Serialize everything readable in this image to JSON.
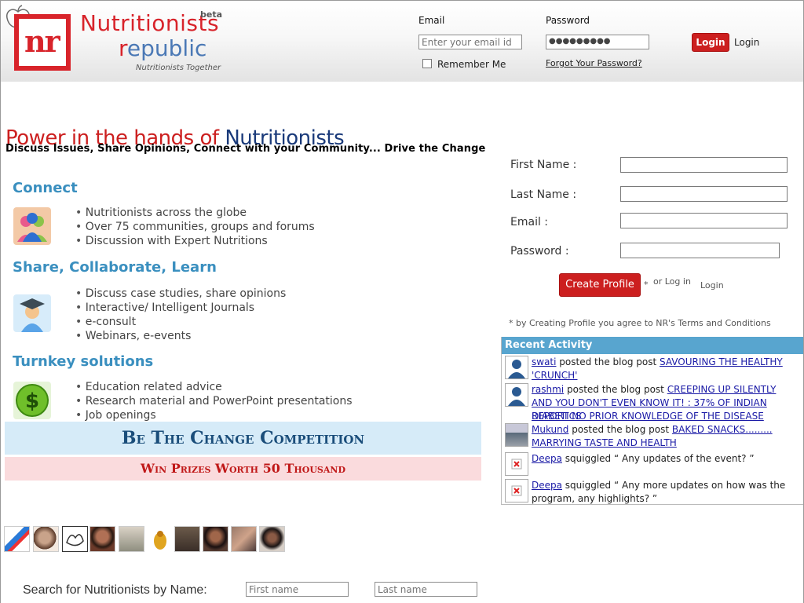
{
  "header": {
    "brand_line1": "Nutritionists",
    "brand_line2": "republic",
    "beta": "beta",
    "tagline": "Nutritionists Together",
    "logo_text": "nr",
    "email_label": "Email",
    "email_placeholder": "Enter your email id",
    "password_label": "Password",
    "password_value": "●●●●●●●●●",
    "remember_me": "Remember Me",
    "forgot_password": "Forgot Your Password?",
    "login_button": "Login",
    "login_link": "Login"
  },
  "hero": {
    "title_red": "Power in the hands of ",
    "title_blue": "Nutritionists",
    "subtitle": "Discuss Issues, Share Opinions, Connect with your Community... Drive the Change"
  },
  "sections": [
    {
      "heading": "Connect",
      "icon": "community-icon",
      "bullets": [
        "Nutritionists across the globe",
        "Over 75 communities, groups and forums",
        "Discussion with Expert Nutritions"
      ]
    },
    {
      "heading": "Share, Collaborate, Learn",
      "icon": "graduate-icon",
      "bullets": [
        "Discuss case studies, share opinions",
        "Interactive/ Intelligent Journals",
        "e-consult",
        "Webinars, e-events"
      ]
    },
    {
      "heading": "Turnkey solutions",
      "icon": "dollar-icon",
      "bullets": [
        "Education related advice",
        "Research material and PowerPoint presentations",
        "Job openings"
      ]
    }
  ],
  "banners": {
    "competition": "Be The Change Competition",
    "prizes": "Win Prizes Worth 50 Thousand"
  },
  "search": {
    "label": "Search for Nutritionists by Name:",
    "first_placeholder": "First name",
    "last_placeholder": "Last name"
  },
  "signup": {
    "first_name": "First Name :",
    "last_name": "Last Name :",
    "email": "Email :",
    "password": "Password :",
    "create_button": "Create Profile",
    "asterisk": "*",
    "or_login": "or Log in",
    "login": "Login",
    "terms": "* by Creating Profile you agree to NR's Terms and Conditions"
  },
  "recent_activity": {
    "heading": "Recent Activity",
    "items": [
      {
        "user": "swati",
        "action": " posted the blog post ",
        "title": "Savouring the healthy 'crunch'"
      },
      {
        "user": "rashmi",
        "action": " posted the blog post ",
        "title": "Creeping up silently and you don't even know it! : 37% of Indian Diabetics"
      },
      {
        "continuation": "Report no prior knowledge of the disease"
      },
      {
        "user": "Mukund",
        "action": " posted the blog post ",
        "title": "Baked Snacks......... Marrying taste and health"
      },
      {
        "user": "Deepa",
        "action": " squiggled ",
        "quote": "“ Any updates of the event? ”"
      },
      {
        "user": "Deepa",
        "action": " squiggled ",
        "quote": "“ Any more updates on how was the program, any highlights? ”"
      }
    ]
  },
  "colors": {
    "brand_red": "#cc1f1f",
    "brand_blue": "#1a3a7a",
    "section_blue": "#3a8fbf",
    "activity_header": "#58a5cf"
  }
}
